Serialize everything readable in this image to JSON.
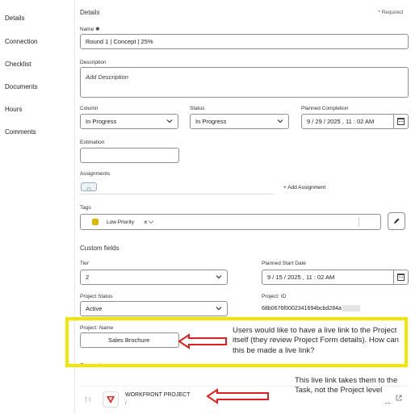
{
  "sidebar": {
    "items": [
      {
        "label": "Details"
      },
      {
        "label": "Connection"
      },
      {
        "label": "Checklist"
      },
      {
        "label": "Documents"
      },
      {
        "label": "Hours"
      },
      {
        "label": "Comments"
      }
    ]
  },
  "details": {
    "section_title": "Details",
    "required_note": "* Required",
    "name_label": "Name",
    "name_value": "Round 1 | Concept |  25%",
    "description_label": "Description",
    "description_placeholder": "Add Description",
    "column_label": "Column",
    "column_value": "In Progress",
    "status_label": "Status",
    "status_value": "In Progress",
    "planned_completion_label": "Planned Completion",
    "planned_completion_value": "9 / 29 / 2025 , 11 : 02   AM",
    "estimation_label": "Estimation",
    "estimation_value": "",
    "assignments_label": "Assignments",
    "add_assignment_label": "+ Add Assignment",
    "tags_label": "Tags",
    "tag_value": "Low Priority",
    "tag_remove": "×",
    "tag_color": "#d9b600"
  },
  "custom_fields": {
    "section_title": "Custom fields",
    "tier_label": "Tier",
    "tier_value": "2",
    "planned_start_label": "Planned Start Date",
    "planned_start_value": "9 / 15 / 2025 , 11 : 02   AM",
    "project_status_label": "Project Status",
    "project_status_value": "Active",
    "project_id_label": "Project: ID",
    "project_id_value": "68b0676f0002341694bcbd284a",
    "project_name_label": "Project: Name",
    "project_name_value": "Sales Brochure"
  },
  "connection": {
    "section_title": "Connection",
    "item_title": "WORKFRONT PROJECT",
    "item_sub": "/",
    "more_label": "...",
    "link_icon": "external-link-icon"
  },
  "annotations": {
    "note_1": "Users would like to have a live link to the Project itself (they review Project Form details). How can this be made a live link?",
    "note_2": "This live link takes them to the Task, not the Project level",
    "highlight_color": "#f2e600",
    "arrow_color": "#e02020"
  }
}
